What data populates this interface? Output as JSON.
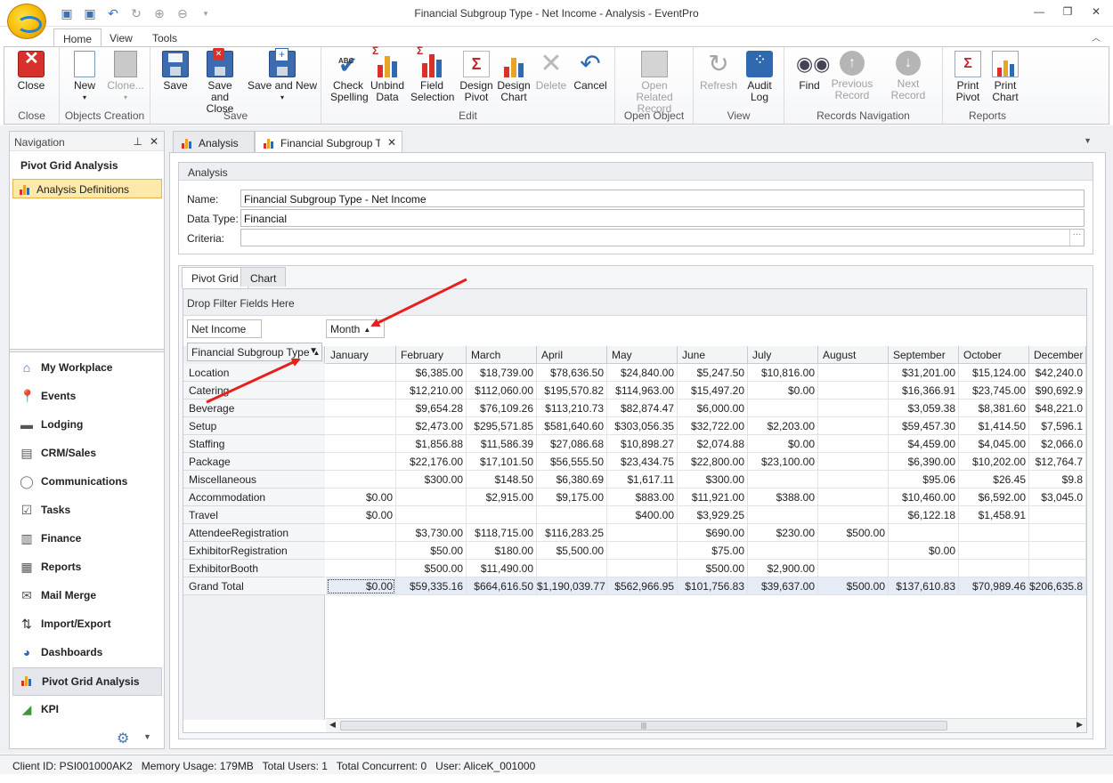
{
  "window": {
    "title": "Financial Subgroup Type - Net Income - Analysis - EventPro"
  },
  "ribbon_tabs": [
    "Home",
    "View",
    "Tools"
  ],
  "ribbon_groups": {
    "close": {
      "label": "Close",
      "buttons": {
        "close": "Close"
      }
    },
    "objects": {
      "label": "Objects Creation",
      "buttons": {
        "new": "New",
        "clone": "Clone..."
      }
    },
    "save": {
      "label": "Save",
      "buttons": {
        "save": "Save",
        "save_close": "Save and Close",
        "save_new": "Save and New"
      }
    },
    "edit": {
      "label": "Edit",
      "buttons": {
        "check": "Check Spelling",
        "unbind": "Unbind Data",
        "field": "Field Selection",
        "design_pivot": "Design Pivot",
        "design_chart": "Design Chart",
        "delete": "Delete",
        "cancel": "Cancel"
      }
    },
    "open": {
      "label": "Open Object",
      "buttons": {
        "open_related": "Open Related Record"
      }
    },
    "view": {
      "label": "View",
      "buttons": {
        "refresh": "Refresh",
        "audit": "Audit Log"
      }
    },
    "records": {
      "label": "Records Navigation",
      "buttons": {
        "find": "Find",
        "previous": "Previous Record",
        "next": "Next Record"
      }
    },
    "reports": {
      "label": "Reports",
      "buttons": {
        "print_pivot": "Print Pivot",
        "print_chart": "Print Chart"
      }
    }
  },
  "navigation": {
    "header": "Navigation",
    "title": "Pivot Grid Analysis",
    "selected": "Analysis Definitions",
    "items": [
      {
        "label": "My Workplace",
        "icon": "home-icon"
      },
      {
        "label": "Events",
        "icon": "pin-icon"
      },
      {
        "label": "Lodging",
        "icon": "bed-icon"
      },
      {
        "label": "CRM/Sales",
        "icon": "contacts-icon"
      },
      {
        "label": "Communications",
        "icon": "speech-bubble-icon"
      },
      {
        "label": "Tasks",
        "icon": "checklist-icon"
      },
      {
        "label": "Finance",
        "icon": "ledger-icon"
      },
      {
        "label": "Reports",
        "icon": "report-icon"
      },
      {
        "label": "Mail Merge",
        "icon": "mail-merge-icon"
      },
      {
        "label": "Import/Export",
        "icon": "import-export-icon"
      },
      {
        "label": "Dashboards",
        "icon": "dashboard-icon"
      },
      {
        "label": "Pivot Grid Analysis",
        "icon": "pivot-icon"
      },
      {
        "label": "KPI",
        "icon": "kpi-icon"
      }
    ]
  },
  "doc_tabs": [
    "Analysis",
    "Financial Subgroup Type"
  ],
  "analysis": {
    "group_title": "Analysis",
    "name_label": "Name:",
    "name_value": "Financial Subgroup Type - Net Income",
    "type_label": "Data Type:",
    "type_value": "Financial",
    "criteria_label": "Criteria:",
    "criteria_value": ""
  },
  "pivot_tabs": [
    "Pivot Grid",
    "Chart"
  ],
  "pivot": {
    "filter_area": "Drop Filter Fields Here",
    "data_field": "Net Income",
    "column_field": "Month",
    "row_field": "Financial Subgroup Type",
    "columns": [
      "January",
      "February",
      "March",
      "April",
      "May",
      "June",
      "July",
      "August",
      "September",
      "October",
      "December"
    ],
    "rows": [
      {
        "label": "Location",
        "values": [
          "",
          "$6,385.00",
          "$18,739.00",
          "$78,636.50",
          "$24,840.00",
          "$5,247.50",
          "$10,816.00",
          "",
          "$31,201.00",
          "$15,124.00",
          "$42,240.0"
        ]
      },
      {
        "label": "Catering",
        "values": [
          "",
          "$12,210.00",
          "$112,060.00",
          "$195,570.82",
          "$114,963.00",
          "$15,497.20",
          "$0.00",
          "",
          "$16,366.91",
          "$23,745.00",
          "$90,692.9"
        ]
      },
      {
        "label": "Beverage",
        "values": [
          "",
          "$9,654.28",
          "$76,109.26",
          "$113,210.73",
          "$82,874.47",
          "$6,000.00",
          "",
          "",
          "$3,059.38",
          "$8,381.60",
          "$48,221.0"
        ]
      },
      {
        "label": "Setup",
        "values": [
          "",
          "$2,473.00",
          "$295,571.85",
          "$581,640.60",
          "$303,056.35",
          "$32,722.00",
          "$2,203.00",
          "",
          "$59,457.30",
          "$1,414.50",
          "$7,596.1"
        ]
      },
      {
        "label": "Staffing",
        "values": [
          "",
          "$1,856.88",
          "$11,586.39",
          "$27,086.68",
          "$10,898.27",
          "$2,074.88",
          "$0.00",
          "",
          "$4,459.00",
          "$4,045.00",
          "$2,066.0"
        ]
      },
      {
        "label": "Package",
        "values": [
          "",
          "$22,176.00",
          "$17,101.50",
          "$56,555.50",
          "$23,434.75",
          "$22,800.00",
          "$23,100.00",
          "",
          "$6,390.00",
          "$10,202.00",
          "$12,764.7"
        ]
      },
      {
        "label": "Miscellaneous",
        "values": [
          "",
          "$300.00",
          "$148.50",
          "$6,380.69",
          "$1,617.11",
          "$300.00",
          "",
          "",
          "$95.06",
          "$26.45",
          "$9.8"
        ]
      },
      {
        "label": "Accommodation",
        "values": [
          "$0.00",
          "",
          "$2,915.00",
          "$9,175.00",
          "$883.00",
          "$11,921.00",
          "$388.00",
          "",
          "$10,460.00",
          "$6,592.00",
          "$3,045.0"
        ]
      },
      {
        "label": "Travel",
        "values": [
          "$0.00",
          "",
          "",
          "",
          "$400.00",
          "$3,929.25",
          "",
          "",
          "$6,122.18",
          "$1,458.91",
          ""
        ]
      },
      {
        "label": "AttendeeRegistration",
        "values": [
          "",
          "$3,730.00",
          "$118,715.00",
          "$116,283.25",
          "",
          "$690.00",
          "$230.00",
          "$500.00",
          "",
          "",
          ""
        ]
      },
      {
        "label": "ExhibitorRegistration",
        "values": [
          "",
          "$50.00",
          "$180.00",
          "$5,500.00",
          "",
          "$75.00",
          "",
          "",
          "$0.00",
          "",
          ""
        ]
      },
      {
        "label": "ExhibitorBooth",
        "values": [
          "",
          "$500.00",
          "$11,490.00",
          "",
          "",
          "$500.00",
          "$2,900.00",
          "",
          "",
          "",
          ""
        ]
      },
      {
        "label": "Grand Total",
        "values": [
          "$0.00",
          "$59,335.16",
          "$664,616.50",
          "$1,190,039.77",
          "$562,966.95",
          "$101,756.83",
          "$39,637.00",
          "$500.00",
          "$137,610.83",
          "$70,989.46",
          "$206,635.8"
        ]
      }
    ]
  },
  "status": {
    "client": "Client ID: PSI001000AK2",
    "memory": "Memory Usage: 179MB",
    "users": "Total Users: 1",
    "concurrent": "Total Concurrent: 0",
    "user": "User: AliceK_001000"
  },
  "colors": {
    "accent": "#2f6ab1",
    "selection": "#fde9a9",
    "annotation_arrow": "#e8201b"
  }
}
